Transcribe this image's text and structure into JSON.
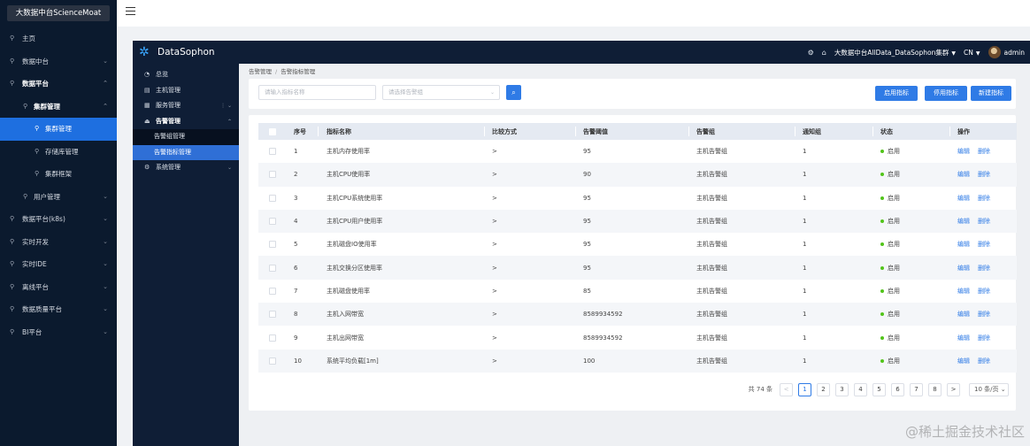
{
  "outer_sidebar": {
    "logo": "大数据中台ScienceMoat",
    "items": [
      {
        "label": "主页"
      },
      {
        "label": "数据中台"
      },
      {
        "label": "数据平台"
      },
      {
        "label": "集群管理"
      },
      {
        "label": "集群管理"
      },
      {
        "label": "存储库管理"
      },
      {
        "label": "集群框架"
      },
      {
        "label": "用户管理"
      },
      {
        "label": "数据平台(k8s)"
      },
      {
        "label": "实时开发"
      },
      {
        "label": "实时IDE"
      },
      {
        "label": "离线平台"
      },
      {
        "label": "数据质量平台"
      },
      {
        "label": "BI平台"
      }
    ]
  },
  "header": {
    "title": "DataSophon",
    "cluster": "大数据中台AllData_DataSophon集群",
    "lang": "CN",
    "user": "admin"
  },
  "inner_sidebar": {
    "items": [
      {
        "label": "总览"
      },
      {
        "label": "主机管理"
      },
      {
        "label": "服务管理"
      },
      {
        "label": "告警管理"
      },
      {
        "label": "告警组管理"
      },
      {
        "label": "告警指标管理"
      },
      {
        "label": "系统管理"
      }
    ]
  },
  "breadcrumb": {
    "parent": "告警管理",
    "current": "告警指标管理"
  },
  "filters": {
    "name_placeholder": "请输入指标名称",
    "group_placeholder": "请选择告警组"
  },
  "buttons": {
    "enable": "启用指标",
    "disable": "停用指标",
    "create": "新建指标"
  },
  "table": {
    "headers": [
      "序号",
      "指标名称",
      "比较方式",
      "告警阈值",
      "告警组",
      "通知组",
      "状态",
      "操作"
    ],
    "rows": [
      {
        "no": "1",
        "name": "主机内存使用率",
        "cmp": ">",
        "threshold": "95",
        "group": "主机告警组",
        "notify": "1",
        "status": "启用"
      },
      {
        "no": "2",
        "name": "主机CPU使用率",
        "cmp": ">",
        "threshold": "90",
        "group": "主机告警组",
        "notify": "1",
        "status": "启用"
      },
      {
        "no": "3",
        "name": "主机CPU系统使用率",
        "cmp": ">",
        "threshold": "95",
        "group": "主机告警组",
        "notify": "1",
        "status": "启用"
      },
      {
        "no": "4",
        "name": "主机CPU用户使用率",
        "cmp": ">",
        "threshold": "95",
        "group": "主机告警组",
        "notify": "1",
        "status": "启用"
      },
      {
        "no": "5",
        "name": "主机磁盘IO使用率",
        "cmp": ">",
        "threshold": "95",
        "group": "主机告警组",
        "notify": "1",
        "status": "启用"
      },
      {
        "no": "6",
        "name": "主机交换分区使用率",
        "cmp": ">",
        "threshold": "95",
        "group": "主机告警组",
        "notify": "1",
        "status": "启用"
      },
      {
        "no": "7",
        "name": "主机磁盘使用率",
        "cmp": ">",
        "threshold": "85",
        "group": "主机告警组",
        "notify": "1",
        "status": "启用"
      },
      {
        "no": "8",
        "name": "主机入网带宽",
        "cmp": ">",
        "threshold": "8589934592",
        "group": "主机告警组",
        "notify": "1",
        "status": "启用"
      },
      {
        "no": "9",
        "name": "主机出网带宽",
        "cmp": ">",
        "threshold": "8589934592",
        "group": "主机告警组",
        "notify": "1",
        "status": "启用"
      },
      {
        "no": "10",
        "name": "系统平均负载[1m]",
        "cmp": ">",
        "threshold": "100",
        "group": "主机告警组",
        "notify": "1",
        "status": "启用"
      }
    ],
    "edit_label": "编辑",
    "delete_label": "删除"
  },
  "pagination": {
    "total": "共 74 条",
    "prev": "<",
    "pages": [
      "1",
      "2",
      "3",
      "4",
      "5",
      "6",
      "7",
      "8"
    ],
    "current": "1",
    "next": ">",
    "page_size": "10 条/页"
  },
  "watermark": "@稀土掘金技术社区",
  "colors": {
    "accent": "#2f7be6",
    "sidebar_bg": "#0b1a2e",
    "header_bg": "#0f1e36",
    "status_on": "#52c41a"
  }
}
